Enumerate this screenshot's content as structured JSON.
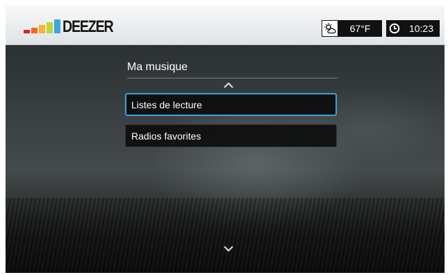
{
  "brand": {
    "name": "DEEZER",
    "eq_colors": [
      "#d8232a",
      "#f26b1d",
      "#f9b233",
      "#c2d638",
      "#3aa8df",
      "#8c4b9f"
    ]
  },
  "status": {
    "weather_icon": "sun-cloud-icon",
    "temperature": "67°F",
    "clock_icon": "clock-icon",
    "time": "10:23"
  },
  "menu": {
    "title": "Ma musique",
    "items": [
      {
        "label": "Listes de lecture",
        "selected": true
      },
      {
        "label": "Radios favorites",
        "selected": false
      }
    ],
    "scroll_up_icon": "chevron-up-icon",
    "scroll_down_icon": "chevron-down-icon"
  },
  "colors": {
    "selection_border": "#3aa3de",
    "item_background": "#0a0a0a",
    "topbar_background": "#eef0f1"
  }
}
